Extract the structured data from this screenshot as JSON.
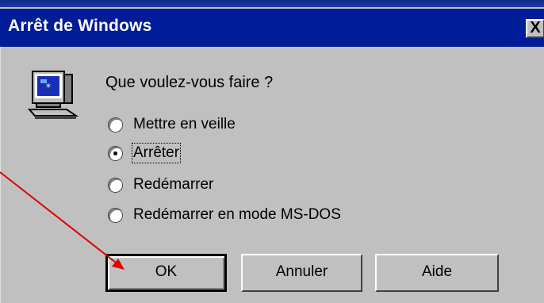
{
  "dialog": {
    "title": "Arrêt de Windows",
    "close_label": "X",
    "question": "Que voulez-vous faire ?",
    "options": [
      {
        "label": "Mettre en veille",
        "selected": false
      },
      {
        "label": "Arrêter",
        "selected": true
      },
      {
        "label": "Redémarrer",
        "selected": false
      },
      {
        "label": "Redémarrer en mode MS-DOS",
        "selected": false
      }
    ],
    "buttons": {
      "ok": "OK",
      "cancel": "Annuler",
      "help": "Aide"
    }
  },
  "colors": {
    "titlebar": "#001c98",
    "face": "#c0c0c0",
    "annotation_arrow": "#e00000"
  },
  "icons": [
    "computer-icon",
    "close-icon",
    "red-arrow-annotation"
  ]
}
